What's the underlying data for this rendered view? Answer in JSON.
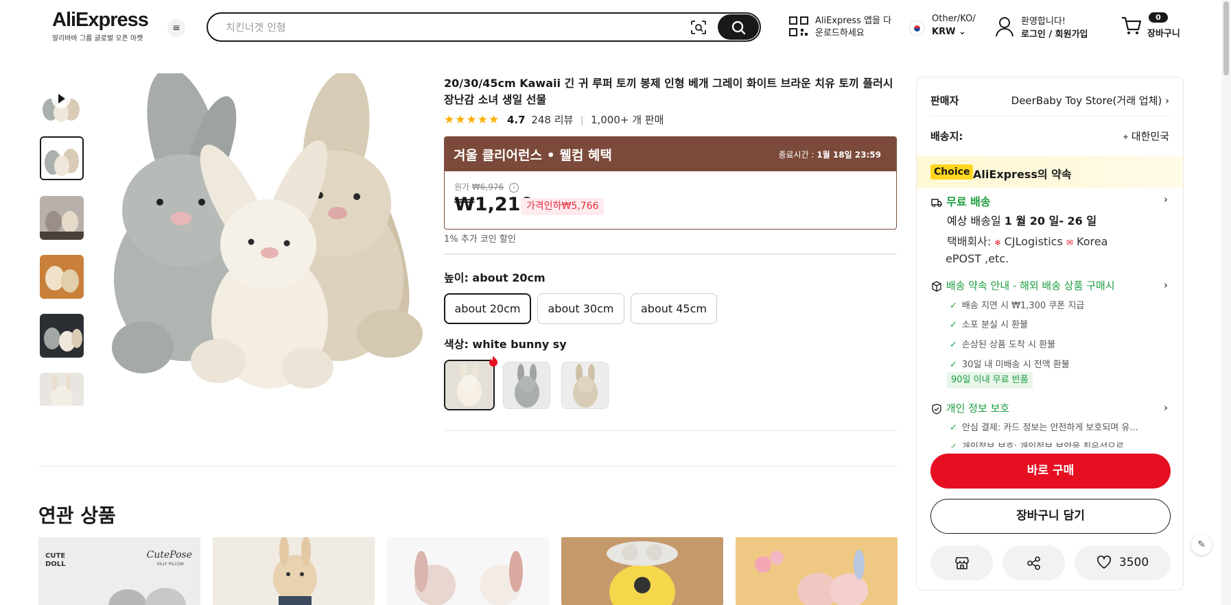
{
  "header": {
    "logo": "AliExpress",
    "logo_sub": "알리바바 그룹 글로벌 오픈 마켓",
    "menu_icon": "hamburger-icon",
    "search_placeholder": "치킨너겟 인형",
    "app_line1": "AliExpress 앱을 다",
    "app_line2": "운로드하세요",
    "lang_line1": "Other/KO/",
    "lang_line2": "KRW",
    "user_line1": "환영합니다!",
    "user_line2": "로그인 / 회원가입",
    "cart_count": "0",
    "cart_label": "장바구니"
  },
  "product": {
    "title": "20/30/45cm Kawaii 긴 귀 루퍼 토끼 봉제 인형 베개 그레이 화이트 브라운 치유 토끼 플러시 장난감 소녀 생일 선물",
    "stars": "★★★★★",
    "rating": "4.7",
    "reviews": "248 리뷰",
    "sold": "1,000+ 개 판매",
    "promo_title": "겨울 클리어런스 • 웰컴 혜택",
    "promo_time_label": "종료시간 :",
    "promo_time": "1월 18일 23:59",
    "orig_label": "원가",
    "orig_price": "₩6,976",
    "price": "₩1,210",
    "discount": "가격인하₩5,766",
    "coin": "1% 추가 코인 할인",
    "size_label": "높이: ",
    "size_value": "about 20cm",
    "sizes": [
      "about 20cm",
      "about 30cm",
      "about 45cm"
    ],
    "color_label": "색상: ",
    "color_value": "white bunny sy"
  },
  "related": {
    "title": "연관 상품",
    "card1_text1": "CUTE",
    "card1_text2": "DOLL",
    "card1_text3": "CutePose",
    "card1_text4": "SILLY PILLOW"
  },
  "panel": {
    "seller_label": "판매자",
    "seller_value": "DeerBaby Toy Store(거래 업체)",
    "ship_to_label": "배송지:",
    "ship_to_value": "대한민국",
    "choice_tag": "Choice",
    "choice_text": "AliExpress의 약속",
    "free_ship": "무료 배송",
    "eta_prefix": "예상 배송일 ",
    "eta": "1 월 20 일- 26 일",
    "carrier_line1_prefix": "택배회사: ",
    "carrier1": "CJLogistics",
    "carrier2": "Korea",
    "carrier_line2": "ePOST ,etc.",
    "promise_title": "배송 약속 안내 - 해외 배송 상품 구매시",
    "promises": [
      "배송 지연 시 ₩1,300 쿠폰 지급",
      "소포 분실 시 환불",
      "손상된 상품 도착 시 환불",
      "30일 내 미배송 시 전액 환불"
    ],
    "return_badge": "90일 이내 무료 반품",
    "privacy_title": "개인 정보 보호",
    "privacy_items": [
      "안심 결제: 카드 정보는 안전하게 보호되며 유...",
      "개인정보 보호: 개인정보 보안을 최우선으로..."
    ],
    "buy_now": "바로 구매",
    "add_cart": "장바구니 담기",
    "wishlist_count": "3500"
  },
  "colors": {
    "brand_red": "#e50f21",
    "promo_brown": "#7b4a3a",
    "star": "#fdb000",
    "green": "#1a9c3e",
    "choice_yellow": "#ffd61f"
  }
}
